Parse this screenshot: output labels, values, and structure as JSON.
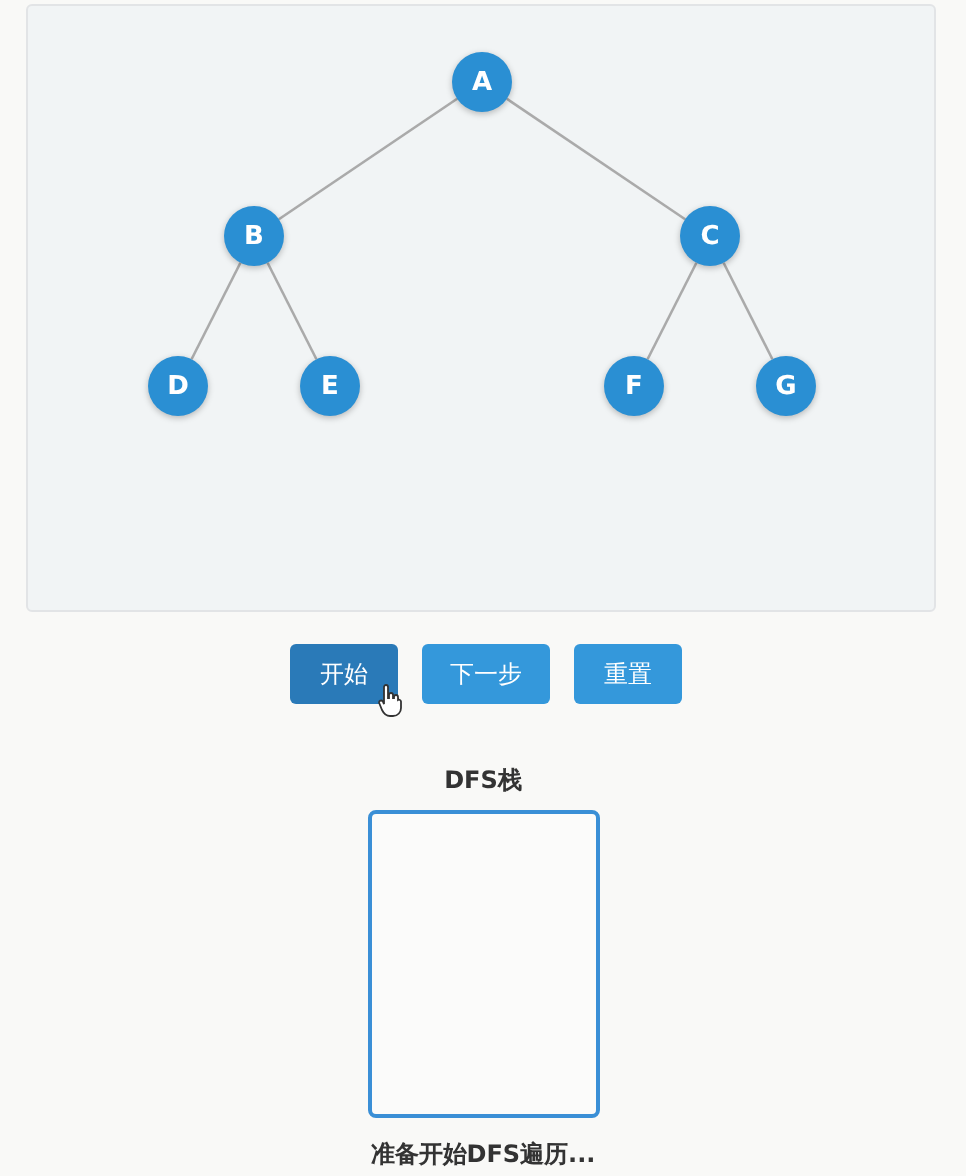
{
  "tree": {
    "label": "A",
    "children": [
      {
        "label": "B",
        "children": [
          {
            "label": "D"
          },
          {
            "label": "E"
          }
        ]
      },
      {
        "label": "C",
        "children": [
          {
            "label": "F"
          },
          {
            "label": "G"
          }
        ]
      }
    ]
  },
  "buttons": [
    {
      "label": "开始",
      "hovered": true
    },
    {
      "label": "下一步",
      "hovered": false
    },
    {
      "label": "重置",
      "hovered": false
    }
  ],
  "stack": {
    "title": "DFS栈"
  },
  "status": "准备开始DFS遍历..."
}
